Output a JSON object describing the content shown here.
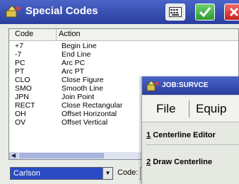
{
  "window": {
    "title": "Special Codes",
    "colors": {
      "titlebar": "#2a3f9e",
      "ok": "#2f9b2f",
      "close": "#c8201e",
      "selection": "#2b4bc4"
    },
    "icons": [
      "app-icon",
      "keyboard-icon",
      "checkmark-icon",
      "close-icon"
    ]
  },
  "list": {
    "columns": [
      "Code",
      "Action"
    ],
    "rows": [
      {
        "code": "+7",
        "action": "Begin Line"
      },
      {
        "code": "-7",
        "action": "End Line"
      },
      {
        "code": "PC",
        "action": "Arc PC"
      },
      {
        "code": "PT",
        "action": "Arc PT"
      },
      {
        "code": "CLO",
        "action": "Close Figure"
      },
      {
        "code": "SMO",
        "action": "Smooth Line"
      },
      {
        "code": "JPN",
        "action": "Join Point"
      },
      {
        "code": "RECT",
        "action": "Close Rectangular"
      },
      {
        "code": "OH",
        "action": "Offset Horizontal"
      },
      {
        "code": "OV",
        "action": "Offset Vertical"
      }
    ]
  },
  "bottom": {
    "style_value": "Carlson",
    "code_label": "Code:",
    "code_value": ""
  },
  "popup": {
    "title": "JOB:SURVCE",
    "menu": {
      "file": "File",
      "equip": "Equip"
    },
    "items": [
      {
        "num": "1",
        "label": "Centerline Editor"
      },
      {
        "num": "2",
        "label": "Draw Centerline"
      }
    ]
  }
}
